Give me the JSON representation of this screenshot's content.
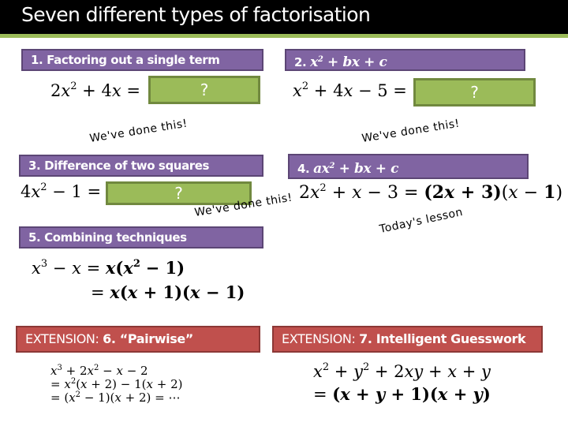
{
  "slide": {
    "title": "Seven different types of factorisation",
    "colors": {
      "header_purple": "#8064a2",
      "answer_green": "#9bbb59",
      "extension_red": "#c0504d",
      "title_bar": "#000000"
    }
  },
  "sections": {
    "s1": {
      "header": "1. Factoring out a single term",
      "equation_lhs": "2x² + 4x =",
      "answer": "?",
      "note": "We've done this!"
    },
    "s2": {
      "header_prefix": "2.",
      "header_math": "x² + bx + c",
      "equation_lhs": "x² + 4x − 5 =",
      "answer": "?",
      "note": "We've done this!"
    },
    "s3": {
      "header": "3. Difference of two squares",
      "equation_lhs": "4x² − 1 =",
      "answer": "?",
      "note": "We've done this!"
    },
    "s4": {
      "header_prefix": "4.",
      "header_math": "ax² + bx + c",
      "equation": "2x² + x − 3 = (2x + 3)(x − 1)",
      "note": "Today's lesson"
    },
    "s5": {
      "header": "5. Combining techniques",
      "lines": [
        "x³ − x = x(x² − 1)",
        "= x(x + 1)(x − 1)"
      ]
    },
    "s6": {
      "header_prefix": "EXTENSION:",
      "header_bold": "6. “Pairwise”",
      "lines": [
        "x³ + 2x² − x − 2",
        "= x²(x + 2) − 1(x + 2)",
        "= (x² − 1)(x + 2) = ⋯"
      ]
    },
    "s7": {
      "header_prefix": "EXTENSION:",
      "header_bold": "7. Intelligent Guesswork",
      "lines": [
        "x² + y² + 2xy + x + y",
        "= (x + y + 1)(x + y)"
      ]
    }
  }
}
